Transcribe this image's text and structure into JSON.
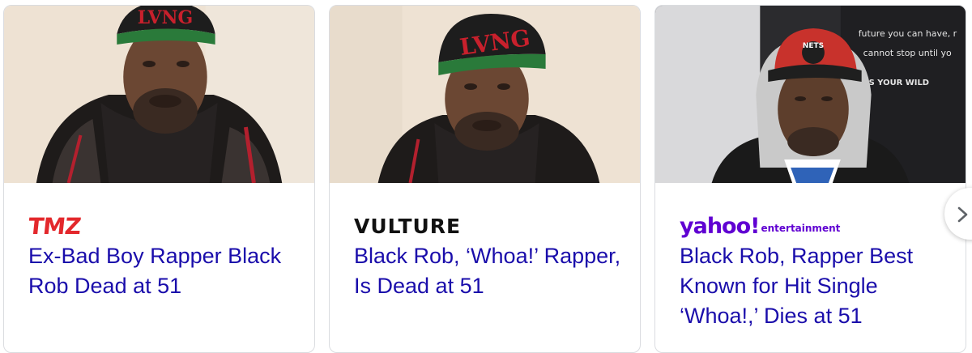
{
  "cards": [
    {
      "source": "TMZ",
      "headline": "Ex-Bad Boy Rapper Black Rob Dead at 51",
      "cap_text": "LVNG"
    },
    {
      "source": "VULTURE",
      "headline": "Black Rob, ‘Whoa!’ Rapper, Is Dead at 51",
      "cap_text": "LVNG"
    },
    {
      "source": "yahoo!",
      "source_sub": "entertainment",
      "headline": "Black Rob, Rapper Best Known for Hit Single ‘Whoa!,’ Dies at 51",
      "cap_text": "NETS",
      "backdrop_lines": [
        "future you can have, r",
        "cannot stop until yo",
        "'S YOUR WILD"
      ]
    }
  ],
  "carousel": {
    "next_icon": "chevron-right-icon"
  },
  "colors": {
    "headline": "#1a0dab",
    "tmz": "#e3282c",
    "yahoo": "#6001d2",
    "border": "#dadce0"
  }
}
